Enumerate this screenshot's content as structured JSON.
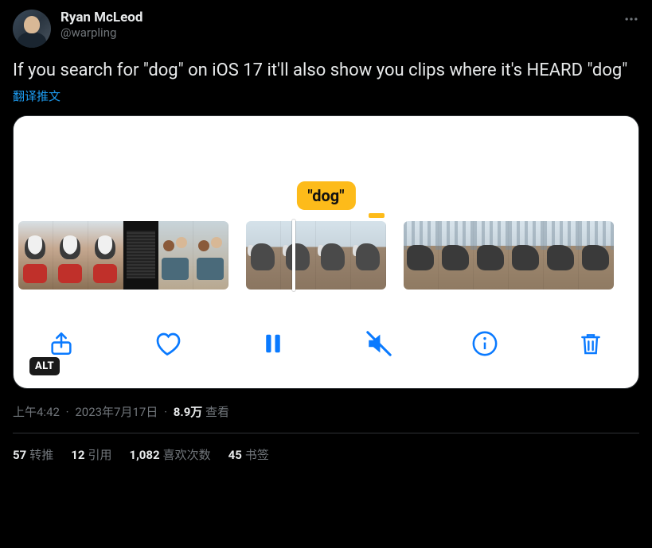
{
  "author": {
    "display_name": "Ryan McLeod",
    "handle": "@warpling"
  },
  "tweet_text": "If you search for \"dog\" on iOS 17 it'll also show you clips where it's HEARD \"dog\"",
  "translate_label": "翻译推文",
  "media": {
    "caption_tag": "\"dog\"",
    "alt_badge": "ALT"
  },
  "meta": {
    "time": "上午4:42",
    "date": "2023年7月17日",
    "views_count": "8.9万",
    "views_label": "查看"
  },
  "stats": {
    "retweets": {
      "count": "57",
      "label": "转推"
    },
    "quotes": {
      "count": "12",
      "label": "引用"
    },
    "likes": {
      "count": "1,082",
      "label": "喜欢次数"
    },
    "bookmarks": {
      "count": "45",
      "label": "书签"
    }
  }
}
